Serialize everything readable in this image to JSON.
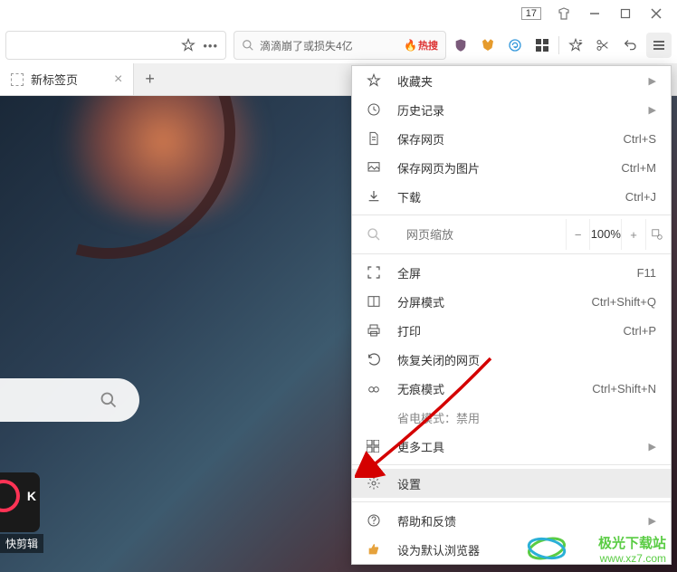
{
  "titlebar": {
    "badge": "17"
  },
  "tabs": {
    "active": "新标签页"
  },
  "searchbox": {
    "placeholder": "滴滴崩了或损失4亿",
    "hotsearch_label": "热搜"
  },
  "menu": {
    "favorites": "收藏夹",
    "history": "历史记录",
    "save_page": "保存网页",
    "save_page_shortcut": "Ctrl+S",
    "save_as_image": "保存网页为图片",
    "save_as_image_shortcut": "Ctrl+M",
    "downloads": "下载",
    "downloads_shortcut": "Ctrl+J",
    "zoom_label": "网页缩放",
    "zoom_value": "100%",
    "fullscreen": "全屏",
    "fullscreen_shortcut": "F11",
    "split": "分屏模式",
    "split_shortcut": "Ctrl+Shift+Q",
    "print": "打印",
    "print_shortcut": "Ctrl+P",
    "reopen_closed": "恢复关闭的网页",
    "incognito": "无痕模式",
    "incognito_shortcut": "Ctrl+Shift+N",
    "power_saving": "省电模式：禁用",
    "more_tools": "更多工具",
    "settings": "设置",
    "help": "帮助和反馈",
    "set_default": "设为默认浏览器"
  },
  "bottom_label": "快剪辑",
  "watermark": {
    "line1": "极光下载站",
    "line2": "www.xz7.com"
  }
}
